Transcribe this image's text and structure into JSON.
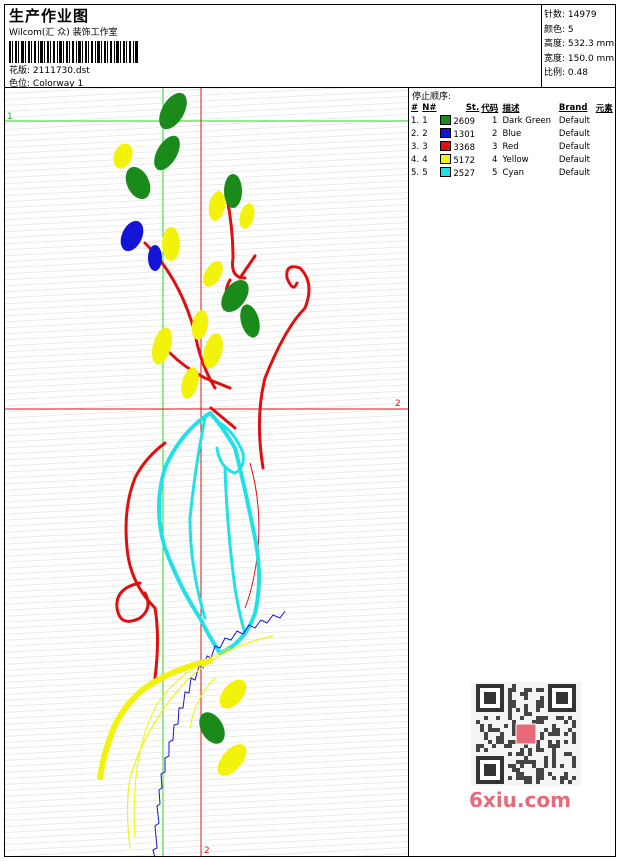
{
  "header": {
    "title": "生产作业图",
    "company": "Wilcom(汇 众) 装饰工作室",
    "design_label": "花版:",
    "design_value": "2111730.dst",
    "colorway_label": "色位:",
    "colorway_value": "Colorway 1"
  },
  "stats": [
    {
      "label": "针数:",
      "value": "14979"
    },
    {
      "label": "颜色:",
      "value": "5"
    },
    {
      "label": "高度:",
      "value": "532.3 mm"
    },
    {
      "label": "宽度:",
      "value": "150.0 mm"
    },
    {
      "label": "比例:",
      "value": "0.48"
    }
  ],
  "stop_sequence": {
    "title": "停止顺序:",
    "headers": [
      "#",
      "N#",
      "St.",
      "代码",
      "描述",
      "Brand",
      "元素"
    ],
    "rows": [
      {
        "n": "1.",
        "num": "1",
        "color": "#1a8a1a",
        "stitch": "2609",
        "code": "1",
        "desc": "Dark Green",
        "brand": "Default"
      },
      {
        "n": "2.",
        "num": "2",
        "color": "#1515d8",
        "stitch": "1301",
        "code": "2",
        "desc": "Blue",
        "brand": "Default"
      },
      {
        "n": "3.",
        "num": "3",
        "color": "#e01010",
        "stitch": "3368",
        "code": "3",
        "desc": "Red",
        "brand": "Default"
      },
      {
        "n": "4.",
        "num": "4",
        "color": "#f2f20a",
        "stitch": "5172",
        "code": "4",
        "desc": "Yellow",
        "brand": "Default"
      },
      {
        "n": "5.",
        "num": "5",
        "color": "#20e0e8",
        "stitch": "2527",
        "code": "5",
        "desc": "Cyan",
        "brand": "Default"
      }
    ]
  },
  "canvas": {
    "guide_h1_label": "1",
    "guide_h2_label": "2",
    "guide_v2_label": "2"
  },
  "watermark": {
    "text": "6xiu.com"
  }
}
